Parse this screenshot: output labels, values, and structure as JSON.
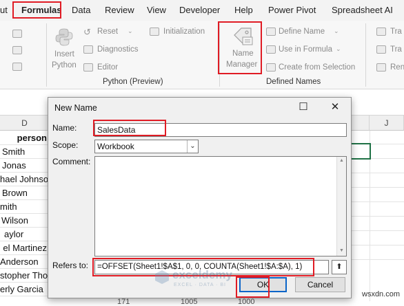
{
  "ribbon": {
    "tabs": [
      "ut",
      "Formulas",
      "Data",
      "Review",
      "View",
      "Developer",
      "Help",
      "Power Pivot",
      "Spreadsheet AI"
    ],
    "python_group": {
      "insert_python": [
        "Insert",
        "Python"
      ],
      "reset": "Reset",
      "diagnostics": "Diagnostics",
      "editor": "Editor",
      "initialization": "Initialization",
      "label": "Python (Preview)"
    },
    "defined_names_group": {
      "name_manager": [
        "Name",
        "Manager"
      ],
      "define_name": "Define Name",
      "use_in_formula": "Use in Formula",
      "create_from_selection": "Create from Selection",
      "label": "Defined Names"
    },
    "truncated": [
      "Tra",
      "Tra",
      "Ren"
    ]
  },
  "sheet": {
    "columns": [
      "D",
      "J"
    ],
    "rows": [
      "person",
      "Smith",
      "Jonas",
      "hael Johnson",
      "Brown",
      "mith",
      "Wilson",
      "aylor",
      "el Martinez",
      "Anderson",
      "stopher Thom",
      "erly Garcia"
    ],
    "partial_row_values": [
      "171",
      "1005",
      "1000"
    ]
  },
  "dialog": {
    "title": "New Name",
    "maximize_icon": "☐",
    "close_icon": "✕",
    "name_label": "Name:",
    "name_value": "SalesData",
    "scope_label": "Scope:",
    "scope_value": "Workbook",
    "comment_label": "Comment:",
    "comment_value": "",
    "refers_to_label": "Refers to:",
    "refers_to_value": "=OFFSET(Sheet1!$A$1, 0, 0, COUNTA(Sheet1!$A:$A), 1)",
    "ok_label": "OK",
    "cancel_label": "Cancel"
  },
  "watermark": {
    "brand": "exceldemy",
    "tagline": "EXCEL · DATA · BI"
  },
  "site": "wsxdn.com",
  "colors": {
    "highlight": "#e01b24",
    "excel_green": "#1e7145",
    "ok_focus": "#0a64c8"
  }
}
